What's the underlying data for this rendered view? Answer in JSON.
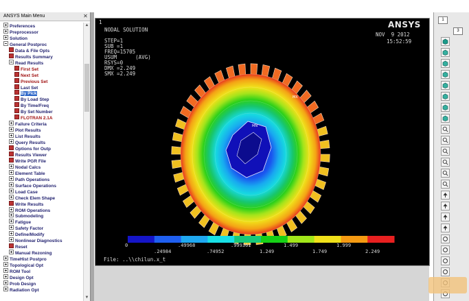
{
  "main_menu": {
    "title": "ANSYS Main Menu",
    "items": [
      {
        "label": "Preferences",
        "level": 0,
        "kind": "plus",
        "style": "normal"
      },
      {
        "label": "Preprocessor",
        "level": 0,
        "kind": "plus",
        "style": "normal"
      },
      {
        "label": "Solution",
        "level": 0,
        "kind": "plus",
        "style": "normal"
      },
      {
        "label": "General Postproc",
        "level": 0,
        "kind": "minus",
        "style": "normal"
      },
      {
        "label": "Data & File Opts",
        "level": 1,
        "kind": "icon",
        "style": "normal"
      },
      {
        "label": "Results Summary",
        "level": 1,
        "kind": "icon",
        "style": "normal"
      },
      {
        "label": "Read Results",
        "level": 1,
        "kind": "minus",
        "style": "normal"
      },
      {
        "label": "First Set",
        "level": 2,
        "kind": "icon",
        "style": "red"
      },
      {
        "label": "Next Set",
        "level": 2,
        "kind": "icon",
        "style": "red"
      },
      {
        "label": "Previous Set",
        "level": 2,
        "kind": "icon",
        "style": "red"
      },
      {
        "label": "Last Set",
        "level": 2,
        "kind": "icon",
        "style": "normal"
      },
      {
        "label": "By Pick",
        "level": 2,
        "kind": "icon",
        "style": "selected"
      },
      {
        "label": "By Load Step",
        "level": 2,
        "kind": "icon",
        "style": "normal"
      },
      {
        "label": "By Time/Freq",
        "level": 2,
        "kind": "icon",
        "style": "normal"
      },
      {
        "label": "By Set Number",
        "level": 2,
        "kind": "icon",
        "style": "normal"
      },
      {
        "label": "FLOTRAN 2.1A",
        "level": 2,
        "kind": "icon",
        "style": "red"
      },
      {
        "label": "Failure Criteria",
        "level": 1,
        "kind": "plus",
        "style": "normal"
      },
      {
        "label": "Plot Results",
        "level": 1,
        "kind": "plus",
        "style": "normal"
      },
      {
        "label": "List Results",
        "level": 1,
        "kind": "plus",
        "style": "normal"
      },
      {
        "label": "Query Results",
        "level": 1,
        "kind": "plus",
        "style": "normal"
      },
      {
        "label": "Options for Outp",
        "level": 1,
        "kind": "icon",
        "style": "normal"
      },
      {
        "label": "Results Viewer",
        "level": 1,
        "kind": "icon",
        "style": "normal"
      },
      {
        "label": "Write PGR File",
        "level": 1,
        "kind": "icon",
        "style": "normal"
      },
      {
        "label": "Nodal Calcs",
        "level": 1,
        "kind": "plus",
        "style": "normal"
      },
      {
        "label": "Element Table",
        "level": 1,
        "kind": "plus",
        "style": "normal"
      },
      {
        "label": "Path Operations",
        "level": 1,
        "kind": "plus",
        "style": "normal"
      },
      {
        "label": "Surface Operations",
        "level": 1,
        "kind": "plus",
        "style": "normal"
      },
      {
        "label": "Load Case",
        "level": 1,
        "kind": "plus",
        "style": "normal"
      },
      {
        "label": "Check Elem Shape",
        "level": 1,
        "kind": "plus",
        "style": "normal"
      },
      {
        "label": "Write Results",
        "level": 1,
        "kind": "icon",
        "style": "normal"
      },
      {
        "label": "ROM Operations",
        "level": 1,
        "kind": "plus",
        "style": "normal"
      },
      {
        "label": "Submodeling",
        "level": 1,
        "kind": "plus",
        "style": "normal"
      },
      {
        "label": "Fatigue",
        "level": 1,
        "kind": "plus",
        "style": "normal"
      },
      {
        "label": "Safety Factor",
        "level": 1,
        "kind": "plus",
        "style": "normal"
      },
      {
        "label": "Define/Modify",
        "level": 1,
        "kind": "plus",
        "style": "normal"
      },
      {
        "label": "Nonlinear Diagnostics",
        "level": 1,
        "kind": "plus",
        "style": "normal"
      },
      {
        "label": "Reset",
        "level": 1,
        "kind": "icon",
        "style": "normal"
      },
      {
        "label": "Manual Rezoning",
        "level": 1,
        "kind": "plus",
        "style": "normal"
      },
      {
        "label": "TimeHist Postpro",
        "level": 0,
        "kind": "plus",
        "style": "normal"
      },
      {
        "label": "Topological Opt",
        "level": 0,
        "kind": "plus",
        "style": "normal"
      },
      {
        "label": "ROM Tool",
        "level": 0,
        "kind": "plus",
        "style": "normal"
      },
      {
        "label": "Design Opt",
        "level": 0,
        "kind": "plus",
        "style": "normal"
      },
      {
        "label": "Prob Design",
        "level": 0,
        "kind": "plus",
        "style": "normal"
      },
      {
        "label": "Radiation Opt",
        "level": 0,
        "kind": "plus",
        "style": "normal"
      }
    ]
  },
  "graphics": {
    "window_number": "1",
    "title": "NODAL SOLUTION",
    "info_lines": [
      "STEP=1",
      "SUB =1",
      "FREQ=15705",
      "USUM      (AVG)",
      "RSYS=0",
      "DMX =2.249",
      "SMX =2.249"
    ],
    "logo": "ANSYS",
    "date": "NOV  9 2012",
    "time": "15:52:59",
    "file_label": "File: ..\\\\chilun.x_t",
    "mx_label": "MX",
    "mn_label": "MN"
  },
  "legend": {
    "colors": [
      "#1515c8",
      "#1f5ff0",
      "#1fa8f0",
      "#18e0e6",
      "#18c87a",
      "#16d016",
      "#a2e61a",
      "#f0e11a",
      "#f59a12",
      "#e82020"
    ],
    "top_labels": [
      "0",
      ".49968",
      ".999361",
      "1.499",
      "1.999"
    ],
    "bottom_labels": [
      ".24984",
      ".74952",
      "1.249",
      "1.749",
      "2.249"
    ]
  },
  "toolbar": {
    "window_select": "1",
    "view_select": "3",
    "buttons": [
      "iso-view-icon",
      "front-view-icon",
      "top-view-icon",
      "right-view-icon",
      "back-view-icon",
      "bottom-view-icon",
      "left-view-icon",
      "oblique-view-icon",
      "zoom-icon",
      "box-zoom-icon",
      "win-zoom-icon",
      "back-up-icon",
      "zoom-in-icon",
      "zoom-out-icon",
      "pan-up-icon",
      "pan-down-icon",
      "pan-left-icon",
      "pan-right-icon",
      "rotate-x-icon",
      "rotate-y-icon",
      "rotate-z-icon",
      "dynamic-mode-icon",
      "fit-view-icon",
      "reset-view-icon"
    ]
  }
}
